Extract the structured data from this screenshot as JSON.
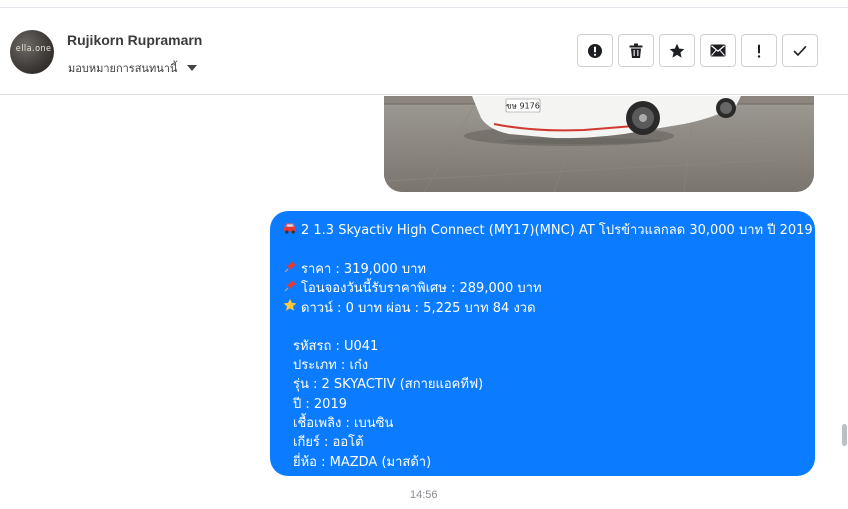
{
  "header": {
    "contact_name": "Rujikorn Rupramarn",
    "assign_label": "มอบหมายการสนทนานี้",
    "avatar_text": "ella.one"
  },
  "actions": [
    {
      "name": "spam-button",
      "icon": "exclamation-circle-icon"
    },
    {
      "name": "delete-button",
      "icon": "trash-icon"
    },
    {
      "name": "star-button",
      "icon": "star-icon"
    },
    {
      "name": "mark-unread-button",
      "icon": "envelope-icon"
    },
    {
      "name": "follow-up-button",
      "icon": "exclamation-icon"
    },
    {
      "name": "mark-done-button",
      "icon": "check-icon"
    }
  ],
  "message": {
    "title": "2 1.3 Skyactiv High Connect (MY17)(MNC) AT โปรข้าวแลกลด 30,000 บาท ปี 2019",
    "price": "ราคา : 319,000 บาท",
    "special_price": "โอนจองวันนี้รับราคาพิเศษ : 289,000 บาท",
    "down_payment": "ดาวน์ : 0 บาท ผ่อน : 5,225 บาท 84 งวด",
    "car_code": "รหัสรถ : U041",
    "car_type": "ประเภท : เก๋ง",
    "model": "รุ่น : 2 SKYACTIV (สกายแอคทีฟ)",
    "year": "ปี : 2019",
    "fuel": "เชื้อเพลิง : เบนซิน",
    "gear": "เกียร์ : ออโต้",
    "brand": "ยี่ห้อ : MAZDA (มาสด้า)",
    "timestamp": "14:56",
    "plate_text": "ขษ 9176"
  },
  "colors": {
    "bubble": "#0b7cff",
    "header_text": "#3a3b3c",
    "timestamp": "#8a8d91"
  }
}
